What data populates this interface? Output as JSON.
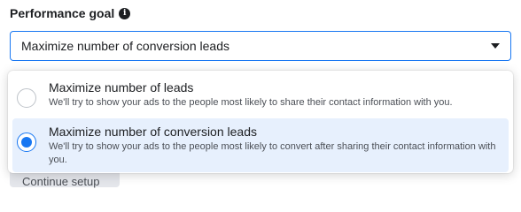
{
  "field": {
    "label": "Performance goal",
    "info_icon": "info-icon",
    "selected_value": "Maximize number of conversion leads",
    "caret_icon": "caret-down-icon"
  },
  "behind": {
    "button_label": "Continue setup"
  },
  "options": [
    {
      "title": "Maximize number of leads",
      "description": "We'll try to show your ads to the people most likely to share their contact information with you.",
      "selected": false
    },
    {
      "title": "Maximize number of conversion leads",
      "description": "We'll try to show your ads to the people most likely to convert after sharing their contact information with you.",
      "selected": true
    }
  ],
  "colors": {
    "accent": "#1877f2",
    "selected_bg": "#e7f0fd"
  }
}
